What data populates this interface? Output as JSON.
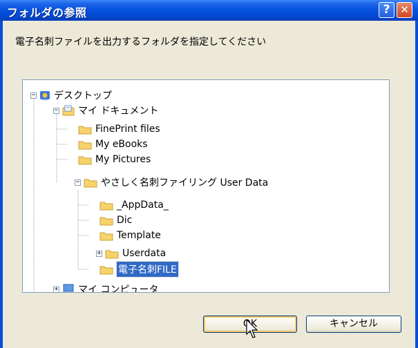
{
  "window": {
    "title": "フォルダの参照",
    "help_label": "?",
    "close_label": "✕"
  },
  "instruction": "電子名刺ファイルを出力するフォルダを指定してください",
  "tree": {
    "desktop": "デスクトップ",
    "mydocs": "マイ ドキュメント",
    "fineprint": "FinePrint files",
    "ebooks": "My eBooks",
    "pictures": "My Pictures",
    "yasashiku": "やさしく名刺ファイリング User Data",
    "appdata": "_AppData_",
    "dic": "Dic",
    "template": "Template",
    "userdata": "Userdata",
    "denshi": "電子名刺FILE",
    "mycomputer": "マイ コンピュータ"
  },
  "buttons": {
    "ok": "OK",
    "cancel": "キャンセル"
  },
  "colors": {
    "title_bar": "#0552de",
    "selection": "#316ac5",
    "dialog_bg": "#ece9d8",
    "folder": "#f6d36b"
  }
}
